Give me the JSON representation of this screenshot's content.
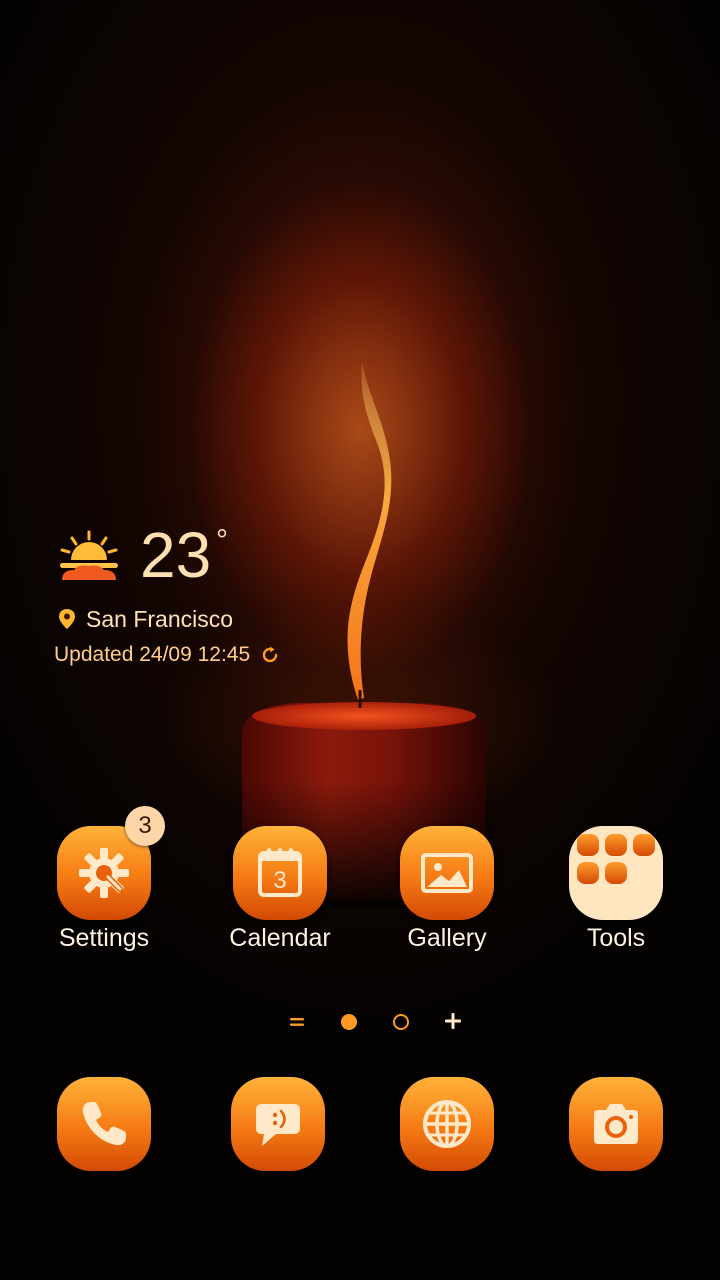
{
  "weather": {
    "temperature": "23",
    "degree_symbol": "°",
    "location": "San Francisco",
    "updated": "Updated 24/09 12:45"
  },
  "apps": {
    "settings": {
      "label": "Settings",
      "badge": "3"
    },
    "calendar": {
      "label": "Calendar",
      "date": "3"
    },
    "gallery": {
      "label": "Gallery"
    },
    "tools": {
      "label": "Tools"
    }
  },
  "dock": [
    "phone-icon",
    "messages-icon",
    "browser-icon",
    "camera-icon"
  ],
  "page_indicator": {
    "pages": 2,
    "current": 1
  },
  "colors": {
    "icon_gradient_top": "#ffb33a",
    "icon_gradient_bottom": "#d24a04",
    "text": "#fff1e0",
    "accent": "#ff9a22"
  }
}
